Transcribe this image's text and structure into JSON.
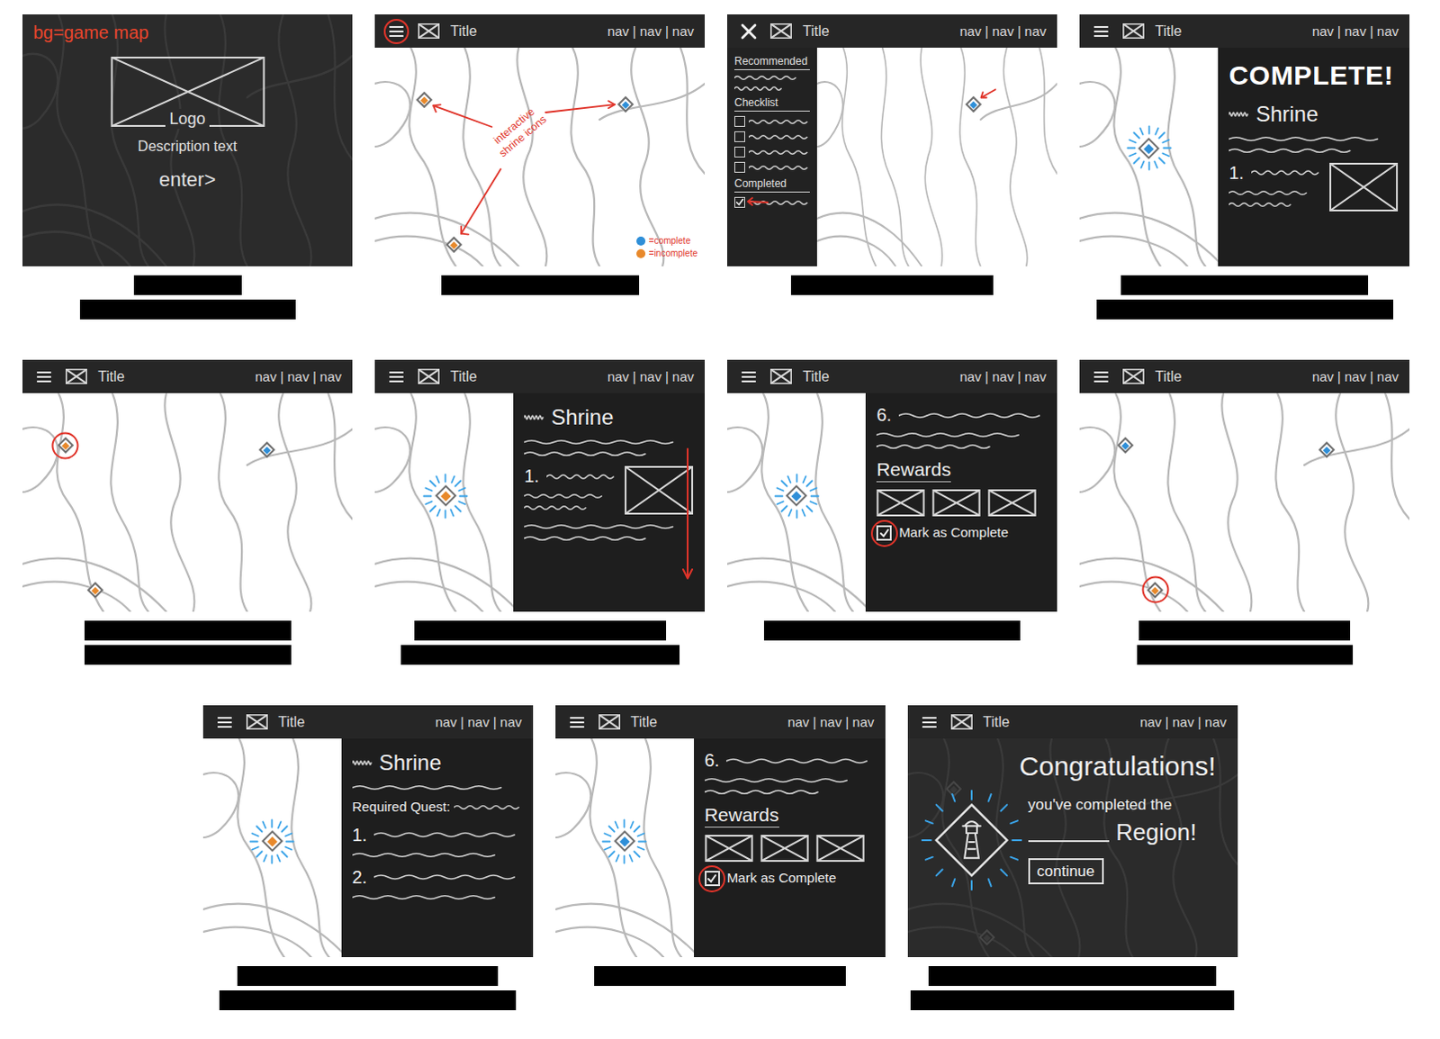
{
  "header": {
    "title": "Title",
    "nav": [
      "nav",
      "nav",
      "nav"
    ],
    "separator": "|"
  },
  "frames": [
    {
      "kind": "title",
      "note": "bg=game map",
      "logo": "Logo",
      "description": "Description text",
      "button": "enter>"
    },
    {
      "kind": "map",
      "menu_open": false,
      "menu_highlighted": true,
      "pins": [
        {
          "complete": false,
          "highlighted": false,
          "glowing": false,
          "annotated": false
        },
        {
          "complete": true,
          "highlighted": false,
          "glowing": false,
          "annotated": false
        },
        {
          "complete": false,
          "highlighted": false,
          "glowing": false,
          "annotated": false
        }
      ],
      "annotation": "interactive shrine icons",
      "legend": [
        {
          "label": "=complete",
          "color": "#2f8fd8"
        },
        {
          "label": "=incomplete",
          "color": "#e8892b"
        }
      ]
    },
    {
      "kind": "menu",
      "menu_open": true,
      "menu_highlighted": false,
      "menu": {
        "sections": [
          {
            "title": "Recommended",
            "lines": 2,
            "items": []
          },
          {
            "title": "Checklist",
            "lines": 0,
            "items": [
              {
                "checked": false,
                "annotated": false
              },
              {
                "checked": false,
                "annotated": false
              },
              {
                "checked": false,
                "annotated": false
              },
              {
                "checked": false,
                "annotated": false
              }
            ]
          },
          {
            "title": "Completed",
            "lines": 0,
            "items": [
              {
                "checked": true,
                "annotated": true
              }
            ]
          }
        ]
      },
      "pins": [
        {
          "complete": true,
          "highlighted": false,
          "glowing": false,
          "annotated": true
        }
      ]
    },
    {
      "kind": "panel",
      "menu_open": false,
      "menu_highlighted": false,
      "pins": [
        {
          "complete": true,
          "highlighted": false,
          "glowing": true,
          "annotated": false
        }
      ],
      "panel": {
        "scroll_hint": false,
        "blocks": [
          {
            "kind": "banner",
            "text": "COMPLETE!"
          },
          {
            "kind": "heading",
            "text": "Shrine"
          },
          {
            "kind": "lines",
            "count": 2
          },
          {
            "kind": "step",
            "number": "1.",
            "image": true,
            "lines": 2
          }
        ]
      }
    },
    {
      "kind": "map",
      "menu_open": false,
      "menu_highlighted": false,
      "pins": [
        {
          "complete": false,
          "highlighted": true,
          "glowing": false,
          "annotated": false
        },
        {
          "complete": true,
          "highlighted": false,
          "glowing": false,
          "annotated": false
        },
        {
          "complete": false,
          "highlighted": false,
          "glowing": false,
          "annotated": false
        }
      ]
    },
    {
      "kind": "panel",
      "menu_open": false,
      "menu_highlighted": false,
      "pins": [
        {
          "complete": false,
          "highlighted": false,
          "glowing": true,
          "annotated": false
        }
      ],
      "panel": {
        "scroll_hint": true,
        "blocks": [
          {
            "kind": "heading",
            "text": "Shrine"
          },
          {
            "kind": "lines",
            "count": 2
          },
          {
            "kind": "step",
            "number": "1.",
            "image": true,
            "lines": 2
          },
          {
            "kind": "lines",
            "count": 2
          }
        ]
      }
    },
    {
      "kind": "panel",
      "menu_open": false,
      "menu_highlighted": false,
      "pins": [
        {
          "complete": true,
          "highlighted": false,
          "glowing": true,
          "annotated": false
        }
      ],
      "panel": {
        "scroll_hint": false,
        "blocks": [
          {
            "kind": "step",
            "number": "6.",
            "image": false,
            "lines": 2
          },
          {
            "kind": "rewards",
            "label": "Rewards",
            "count": 3
          },
          {
            "kind": "mark",
            "label": "Mark as Complete",
            "checked": true,
            "highlighted": true
          }
        ]
      }
    },
    {
      "kind": "map",
      "menu_open": false,
      "menu_highlighted": false,
      "pins": [
        {
          "complete": true,
          "highlighted": false,
          "glowing": false,
          "annotated": false
        },
        {
          "complete": true,
          "highlighted": false,
          "glowing": false,
          "annotated": false
        },
        {
          "complete": false,
          "highlighted": true,
          "glowing": false,
          "annotated": false
        }
      ]
    },
    {
      "kind": "panel",
      "menu_open": false,
      "menu_highlighted": false,
      "pins": [
        {
          "complete": false,
          "highlighted": false,
          "glowing": true,
          "annotated": false
        }
      ],
      "panel": {
        "scroll_hint": false,
        "blocks": [
          {
            "kind": "heading",
            "text": "Shrine"
          },
          {
            "kind": "lines",
            "count": 1
          },
          {
            "kind": "quest",
            "label": "Required Quest:"
          },
          {
            "kind": "step",
            "number": "1.",
            "image": false,
            "lines": 1
          },
          {
            "kind": "step",
            "number": "2.",
            "image": false,
            "lines": 1
          }
        ]
      }
    },
    {
      "kind": "panel",
      "menu_open": false,
      "menu_highlighted": false,
      "pins": [
        {
          "complete": true,
          "highlighted": false,
          "glowing": true,
          "annotated": false
        }
      ],
      "panel": {
        "scroll_hint": false,
        "blocks": [
          {
            "kind": "step",
            "number": "6.",
            "image": false,
            "lines": 2
          },
          {
            "kind": "rewards",
            "label": "Rewards",
            "count": 3
          },
          {
            "kind": "mark",
            "label": "Mark as Complete",
            "checked": true,
            "highlighted": true
          }
        ]
      }
    },
    {
      "kind": "congrats",
      "menu_open": false,
      "menu_highlighted": false,
      "title": "Congratulations!",
      "line": "you've completed the",
      "region": "Region!",
      "button": "continue",
      "pins": [
        {
          "complete": true,
          "highlighted": false,
          "glowing": false,
          "annotated": false
        },
        {
          "complete": true,
          "highlighted": false,
          "glowing": false,
          "annotated": false
        }
      ]
    }
  ]
}
